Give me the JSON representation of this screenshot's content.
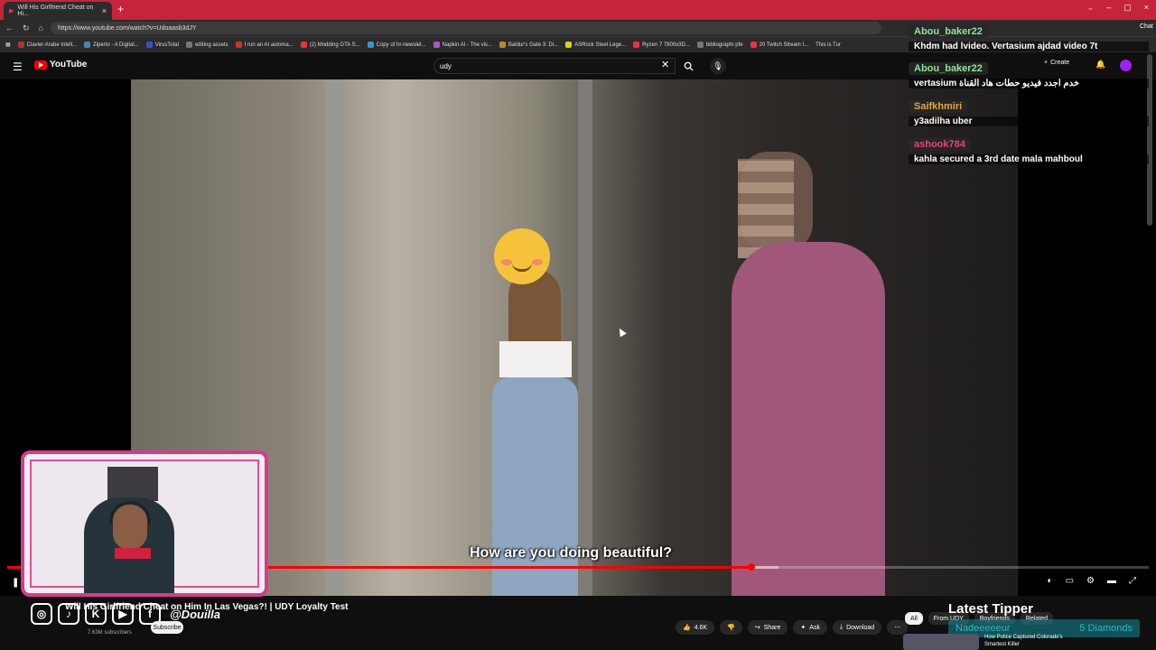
{
  "browser": {
    "tab_title": "Will His Girlfriend Cheat on Hi...",
    "url": "https://www.youtube.com/watch?v=Udoaasb3dJY",
    "bookmarks": [
      "Clavier Arabe Intell...",
      "Ziperto - A Digital...",
      "VirusTotal",
      "editing assets",
      "I run an AI automa...",
      "(2) Modding GTA S...",
      "Copy of hr-newslet...",
      "Napkin AI - The vis...",
      "Baldur's Gate 3: Di...",
      "ASRock Steel Lege...",
      "Ryzen 7 7800x3D...",
      "bibliographi pfe",
      "20 Twitch Stream I...",
      "This is Tur"
    ],
    "chat_button": "Chat"
  },
  "youtube": {
    "logo": "YouTube",
    "search_value": "udy",
    "create_label": "Create"
  },
  "video": {
    "subtitle": "How are you doing beautiful?",
    "progress_fraction": 0.652,
    "buffer_fraction": 0.676
  },
  "below_video": {
    "title": "Will His Girlfriend Cheat on Him In Las Vegas?! | UDY Loyalty Test",
    "subscribers": "7.63M subscribers",
    "subscribe_label": "Subscribe",
    "like_count": "4.6K",
    "share_label": "Share",
    "ask_label": "Ask",
    "download_label": "Download",
    "chips": [
      "All",
      "From UDY",
      "Boyfriends",
      "Related"
    ],
    "rec_title": "How Police Captured Colorado's Smartest Killer"
  },
  "overlay": {
    "handle": "@Douilla",
    "social_icons": [
      "instagram-icon",
      "tiktok-icon",
      "kick-icon",
      "youtube-icon",
      "facebook-icon"
    ],
    "latest_tipper_title": "Latest Tipper",
    "tipper_name": "Nadeeeeeur",
    "tipper_amount": "5 Diamonds"
  },
  "chat": [
    {
      "name": "Abou_baker22",
      "color": "#8fe39a",
      "text": "Khdm had lvideo. Vertasium ajdad video 7t"
    },
    {
      "name": "Abou_baker22",
      "color": "#8fe39a",
      "text": "vertasium خدم اجدد فيديو حطات هاد القناة"
    },
    {
      "name": "Saifkhmiri",
      "color": "#e0a640",
      "text": "y3adilha uber"
    },
    {
      "name": "ashook784",
      "color": "#e0457b",
      "text": "kahla secured a 3rd date mala mahboul"
    }
  ]
}
